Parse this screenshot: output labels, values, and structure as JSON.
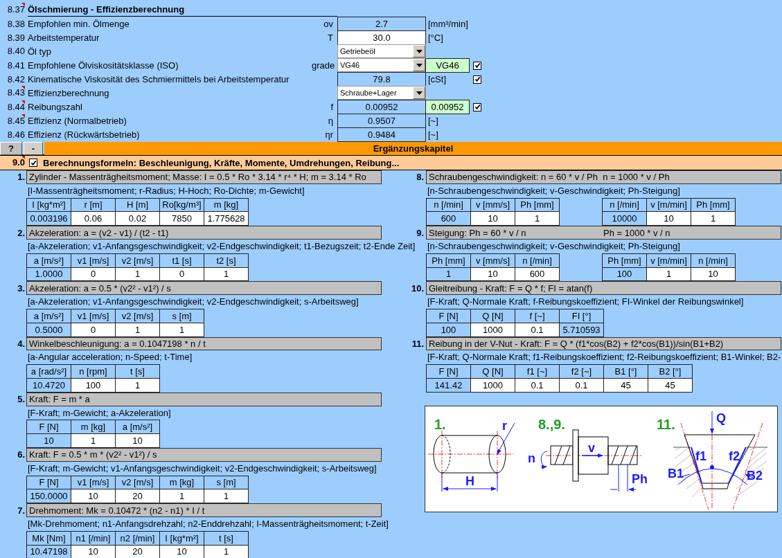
{
  "top_rows": [
    {
      "number": "8.37",
      "comment": true,
      "kind": "heading",
      "label": "Ölschmierung - Effizienzberechnung"
    },
    {
      "number": "8.38",
      "comment": false,
      "kind": "output",
      "label": "Empfohlen min. Ölmenge",
      "symbol": "ov",
      "value": "2.7",
      "unit": "[mm³/min]"
    },
    {
      "number": "8.39",
      "comment": false,
      "kind": "input",
      "label": "Arbeitstemperatur",
      "symbol": "T",
      "value": "30.0",
      "unit": "[°C]"
    },
    {
      "number": "8.40",
      "comment": false,
      "kind": "dropdown",
      "label": "Öl typ",
      "value": "Getriebeöl"
    },
    {
      "number": "8.41",
      "comment": false,
      "kind": "dropdown",
      "label": "Empfohlene Ölviskositätsklasse (ISO)",
      "symbol": "grade",
      "value": "VG46",
      "result": "VG46",
      "checked": true
    },
    {
      "number": "8.42",
      "comment": false,
      "kind": "output",
      "label": "Kinematische Viskosität des Schmiermittels bei Arbeitstemperatur",
      "value": "79.8",
      "unit": "[cSt]",
      "checked": true
    },
    {
      "number": "8.43",
      "comment": true,
      "kind": "dropdown",
      "label": "Effizienzberechnung",
      "value": "Schraube+Lager"
    },
    {
      "number": "8.44",
      "comment": true,
      "kind": "output",
      "label": "Reibungszahl",
      "symbol": "f",
      "value": "0.00952",
      "result": "0.00952",
      "checked": true
    },
    {
      "number": "8.45",
      "comment": true,
      "kind": "output",
      "label": "Effizienz (Normalbetrieb)",
      "symbol": "η",
      "value": "0.9507",
      "unit": "[~]"
    },
    {
      "number": "8.46",
      "comment": false,
      "kind": "output",
      "label": "Effizienz (Rückwärtsbetrieb)",
      "symbol": "ηr",
      "value": "0.9484",
      "unit": "[~]"
    }
  ],
  "chapter_bar": {
    "help": "?",
    "collapse": "-",
    "title": "Ergänzungskapitel"
  },
  "chapter_row": {
    "number": "9.0",
    "comment": true,
    "checked": true,
    "title": "Berechnungsformeln: Beschleunigung, Kräfte, Momente, Umdrehungen, Reibung..."
  },
  "left_sections": [
    {
      "number": "1.",
      "formula": [
        "Zylinder - Massenträgheitsmoment; Masse: I = 0.5 * Ro * 3.14 * r⁴ * H; m = 3.14 * Ro"
      ],
      "legend": "[I-Massenträgheitsmoment; r-Radius; H-Hoch; Ro-Dichte; m-Gewicht]",
      "tables": [
        {
          "columns": [
            "I [kg*m²]",
            "r [m]",
            "H [m]",
            "Ro[kg/m³]",
            "m [kg]"
          ],
          "values": [
            {
              "text": "0.003196",
              "editable": false
            },
            {
              "text": "0.06",
              "editable": true
            },
            {
              "text": "0.02",
              "editable": true
            },
            {
              "text": "7850",
              "editable": true
            },
            {
              "text": "1.775628",
              "editable": true
            }
          ]
        }
      ]
    },
    {
      "number": "2.",
      "formula": [
        "Akzeleration: a = (v2 - v1) / (t2 - t1)"
      ],
      "legend": "[a-Akzeleration; v1-Anfangsgeschwindigkeit; v2-Endgeschwindigkeit; t1-Bezugszeit; t2-Ende Zeit]",
      "tables": [
        {
          "columns": [
            "a [m/s²]",
            "v1 [m/s]",
            "v2 [m/s]",
            "t1 [s]",
            "t2 [s]"
          ],
          "values": [
            {
              "text": "1.0000",
              "editable": false
            },
            {
              "text": "0",
              "editable": true
            },
            {
              "text": "1",
              "editable": true
            },
            {
              "text": "0",
              "editable": true
            },
            {
              "text": "1",
              "editable": true
            }
          ]
        }
      ]
    },
    {
      "number": "3.",
      "formula": [
        "Akzeleration: a = 0.5 * (v2² - v1²) / s"
      ],
      "legend": "[a-Akzeleration; v1-Anfangsgeschwindigkeit; v2-Endgeschwindigkeit; s-Arbeitsweg]",
      "tables": [
        {
          "columns": [
            "a [m/s²]",
            "v1 [m/s]",
            "v2 [m/s]",
            "s [m]"
          ],
          "values": [
            {
              "text": "0.5000",
              "editable": false
            },
            {
              "text": "0",
              "editable": true
            },
            {
              "text": "1",
              "editable": true
            },
            {
              "text": "1",
              "editable": true
            }
          ]
        }
      ]
    },
    {
      "number": "4.",
      "formula": [
        "Winkelbeschleunigung: a = 0.1047198 * n / t"
      ],
      "legend": "[a-Angular acceleration; n-Speed; t-Time]",
      "tables": [
        {
          "columns": [
            "a [rad/s²]",
            "n [rpm]",
            "t [s]"
          ],
          "values": [
            {
              "text": "10.4720",
              "editable": false
            },
            {
              "text": "100",
              "editable": true
            },
            {
              "text": "1",
              "editable": true
            }
          ]
        }
      ]
    },
    {
      "number": "5.",
      "formula": [
        "Kraft: F = m * a"
      ],
      "legend": "[F-Kraft; m-Gewicht; a-Akzeleration]",
      "tables": [
        {
          "columns": [
            "F [N]",
            "m [kg]",
            "a [m/s²]"
          ],
          "values": [
            {
              "text": "10",
              "editable": false
            },
            {
              "text": "1",
              "editable": true
            },
            {
              "text": "10",
              "editable": true
            }
          ]
        }
      ]
    },
    {
      "number": "6.",
      "formula": [
        "Kraft: F = 0.5 * m * (v2² - v1²) / s"
      ],
      "legend": "[F-Kraft; m-Gewicht; v1-Anfangsgeschwindigkeit; v2-Endgeschwindigkeit; s-Arbeitsweg]",
      "tables": [
        {
          "columns": [
            "F [N]",
            "v1 [m/s]",
            "v2 [m/s]",
            "m [kg]",
            "s [m]"
          ],
          "values": [
            {
              "text": "150.0000",
              "editable": false
            },
            {
              "text": "10",
              "editable": true
            },
            {
              "text": "20",
              "editable": true
            },
            {
              "text": "1",
              "editable": true
            },
            {
              "text": "1",
              "editable": true
            }
          ]
        }
      ]
    },
    {
      "number": "7.",
      "formula": [
        "Drehmoment: Mk = 0.10472 * (n2 - n1) * I / t"
      ],
      "legend": "[Mk-Drehmoment; n1-Anfangsdrehzahl; n2-Enddrehzahl; I-Massenträgheitsmoment; t-Zeit]",
      "tables": [
        {
          "columns": [
            "Mk [Nm]",
            "n1 [/min]",
            "n2 [/min]",
            "I [kg*m²]",
            "t [s]"
          ],
          "values": [
            {
              "text": "10.47198",
              "editable": false
            },
            {
              "text": "10",
              "editable": true
            },
            {
              "text": "20",
              "editable": true
            },
            {
              "text": "10",
              "editable": true
            },
            {
              "text": "1",
              "editable": true
            }
          ]
        }
      ]
    }
  ],
  "right_sections": [
    {
      "number": "8.",
      "formula": [
        "Schraubengeschwindigkeit: n = 60 * v / Ph  n = 1000 * v / Ph"
      ],
      "legend": "[n-Schraubengeschwindigkeit; v-Geschwindigkeit; Ph-Steigung]",
      "tables": [
        {
          "columns": [
            "n [/min]",
            "v [mm/s]",
            "Ph [mm]"
          ],
          "values": [
            {
              "text": "600",
              "editable": false
            },
            {
              "text": "10",
              "editable": true
            },
            {
              "text": "1",
              "editable": true
            }
          ]
        },
        {
          "columns": [
            "n [/min]",
            "v [m/min]",
            "Ph [mm]"
          ],
          "values": [
            {
              "text": "10000",
              "editable": false
            },
            {
              "text": "10",
              "editable": true
            },
            {
              "text": "1",
              "editable": true
            }
          ]
        }
      ]
    },
    {
      "number": "9.",
      "formula": [
        "Steigung: Ph = 60 * v / n",
        "Ph = 1000 * v / n"
      ],
      "legend": "[n-Schraubengeschwindigkeit; v-Geschwindigkeit; Ph-Steigung]",
      "tables": [
        {
          "columns": [
            "Ph [mm]",
            "v [mm/s]",
            "n [/min]"
          ],
          "values": [
            {
              "text": "1",
              "editable": false
            },
            {
              "text": "10",
              "editable": true
            },
            {
              "text": "600",
              "editable": true
            }
          ]
        },
        {
          "columns": [
            "Ph [mm]",
            "v [m/min]",
            "n [/min]"
          ],
          "values": [
            {
              "text": "100",
              "editable": false
            },
            {
              "text": "1",
              "editable": true
            },
            {
              "text": "10",
              "editable": true
            }
          ]
        }
      ]
    },
    {
      "number": "10.",
      "formula": [
        "Gleitreibung - Kraft: F = Q * f; FI = atan(f)"
      ],
      "legend": "[F-Kraft; Q-Normale Kraft; f-Reibungskoeffizient; FI-Winkel der Reibungswinkel]",
      "tables": [
        {
          "columns": [
            "F [N]",
            "Q [N]",
            "f [~]",
            "FI [°]"
          ],
          "values": [
            {
              "text": "100",
              "editable": false
            },
            {
              "text": "1000",
              "editable": true
            },
            {
              "text": "0.1",
              "editable": true
            },
            {
              "text": "5.710593",
              "editable": false
            }
          ]
        }
      ]
    },
    {
      "number": "11.",
      "formula": [
        "Reibung in der V-Nut - Kraft: F = Q * (f1*cos(B2) + f2*cos(B1))/sin(B1+B2)"
      ],
      "legend": "[F-Kraft; Q-Normale Kraft; f1-Reibungskoeffizient; f2-Reibungskoeffizient; B1-Winkel; B2-",
      "tables": [
        {
          "columns": [
            "F [N]",
            "Q [N]",
            "f1 [~]",
            "f2 [~]",
            "B1 [°]",
            "B2 [°]"
          ],
          "values": [
            {
              "text": "141.42",
              "editable": false
            },
            {
              "text": "1000",
              "editable": true
            },
            {
              "text": "0.1",
              "editable": true
            },
            {
              "text": "0.1",
              "editable": true
            },
            {
              "text": "45",
              "editable": true
            },
            {
              "text": "45",
              "editable": true
            }
          ]
        }
      ]
    }
  ],
  "diagram": {
    "panels": [
      {
        "title": "1.",
        "labels": [
          "r",
          "H"
        ]
      },
      {
        "title": "8.,9.",
        "labels": [
          "n",
          "v",
          "Ph"
        ]
      },
      {
        "title": "11.",
        "labels": [
          "Q",
          "f1",
          "f2",
          "B1",
          "B2"
        ]
      }
    ]
  }
}
